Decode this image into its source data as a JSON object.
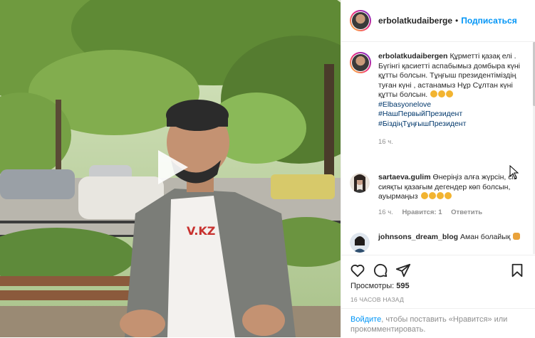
{
  "header": {
    "username": "erbolatkudaiberge",
    "separator": "•",
    "follow_label": "Подписаться"
  },
  "caption": {
    "username": "erbolatkudaibergen",
    "text": "Құрметті қазақ елі . Бүгінгі қасиетті аспабымыз домбыра күні құтты болсын. Тұңғыш президентіміздің туған күні , астанамыз Нұр Сұлтан күні құтты болсын.",
    "emojis": [
      "clap",
      "clap",
      "clap"
    ],
    "hashtags": [
      "#Elbasyonelove",
      "#НашПервыйПрезидент",
      "#БіздіңТұңғышПрезидент"
    ],
    "time": "16 ч."
  },
  "comments": [
    {
      "username": "sartaeva.gulim",
      "text": "Өнеріңіз алға жүрсін, сіз сияқты қазағым дегендер көп болсын, ауырмаңыз",
      "emojis": [
        "clap",
        "clap",
        "clap",
        "thumbs-up"
      ],
      "time": "16 ч.",
      "likes": "Нравится: 1",
      "reply_label": "Ответить"
    },
    {
      "username": "johnsons_dream_blog",
      "text": "Аман болайық",
      "emojis": [
        "flexed-biceps"
      ]
    }
  ],
  "actions": {
    "icons": [
      "heart-icon",
      "comment-icon",
      "share-icon",
      "bookmark-icon"
    ]
  },
  "stats": {
    "views_label": "Просмотры:",
    "views_value": "595",
    "posted": "16 ЧАСОВ НАЗАД"
  },
  "login": {
    "link": "Войдите",
    "text": ", чтобы поставить «Нравится» или прокомментировать."
  },
  "colors": {
    "accent": "#0095f6",
    "hashtag": "#00376b",
    "muted": "#8e8e8e"
  },
  "media": {
    "type": "video",
    "play_icon": "play-icon"
  }
}
